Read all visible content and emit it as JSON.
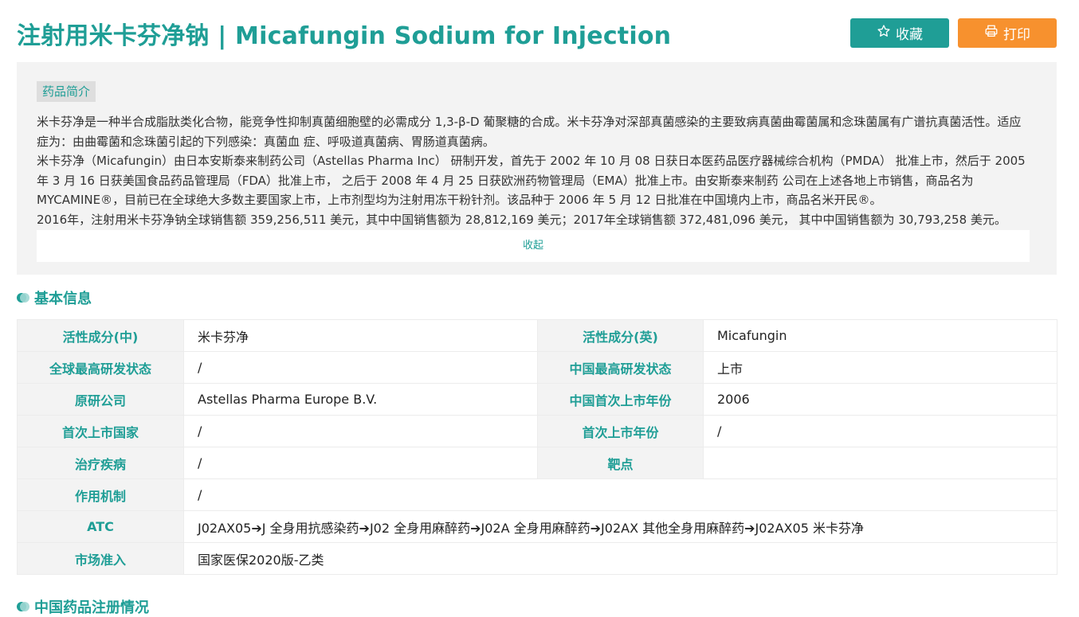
{
  "header": {
    "title": "注射用米卡芬净钠 | Micafungin Sodium for Injection",
    "favorite_label": "收藏",
    "print_label": "打印"
  },
  "intro": {
    "tag": "药品简介",
    "paragraphs": [
      "米卡芬净是一种半合成脂肽类化合物，能竞争性抑制真菌细胞壁的必需成分 1,3-β-D 葡聚糖的合成。米卡芬净对深部真菌感染的主要致病真菌曲霉菌属和念珠菌属有广谱抗真菌活性。适应症为：由曲霉菌和念珠菌引起的下列感染：真菌血 症、呼吸道真菌病、胃肠道真菌病。",
      "米卡芬净（Micafungin）由日本安斯泰来制药公司（Astellas Pharma Inc） 研制开发，首先于 2002 年 10 月 08 日获日本医药品医疗器械综合机构（PMDA） 批准上市，然后于 2005 年 3 月 16 日获美国食品药品管理局（FDA）批准上市， 之后于 2008 年 4 月 25 日获欧洲药物管理局（EMA）批准上市。由安斯泰来制药 公司在上述各地上市销售，商品名为 MYCAMINE®，目前已在全球绝大多数主要国家上市，上市剂型均为注射用冻干粉针剂。该品种于 2006 年 5 月 12 日批准在中国境内上市，商品名米开民®。",
      "2016年，注射用米卡芬净钠全球销售额 359,256,511 美元，其中中国销售额为 28,812,169 美元；2017年全球销售额 372,481,096 美元， 其中中国销售额为 30,793,258 美元。"
    ],
    "collapse_label": "收起"
  },
  "basic_info": {
    "heading": "基本信息",
    "rows": [
      {
        "l1": "活性成分(中)",
        "v1": "米卡芬净",
        "l2": "活性成分(英)",
        "v2": "Micafungin"
      },
      {
        "l1": "全球最高研发状态",
        "v1": "/",
        "l2": "中国最高研发状态",
        "v2": "上市"
      },
      {
        "l1": "原研公司",
        "v1": "Astellas Pharma Europe B.V.",
        "l2": "中国首次上市年份",
        "v2": "2006"
      },
      {
        "l1": "首次上市国家",
        "v1": "/",
        "l2": "首次上市年份",
        "v2": "/"
      },
      {
        "l1": "治疗疾病",
        "v1": "/",
        "l2": "靶点",
        "v2": ""
      }
    ],
    "wide_rows": [
      {
        "label": "作用机制",
        "value": "/"
      },
      {
        "label": "ATC",
        "value": "J02AX05➔J 全身用抗感染药➔J02 全身用麻醉药➔J02A 全身用麻醉药➔J02AX 其他全身用麻醉药➔J02AX05 米卡芬净"
      },
      {
        "label": "市场准入",
        "value": "国家医保2020版-乙类"
      }
    ]
  },
  "next_section": {
    "heading": "中国药品注册情况"
  },
  "colors": {
    "accent": "#1f9e96",
    "print_button": "#f7912e"
  },
  "icons": {
    "favorite": "star-icon",
    "print": "printer-icon"
  }
}
